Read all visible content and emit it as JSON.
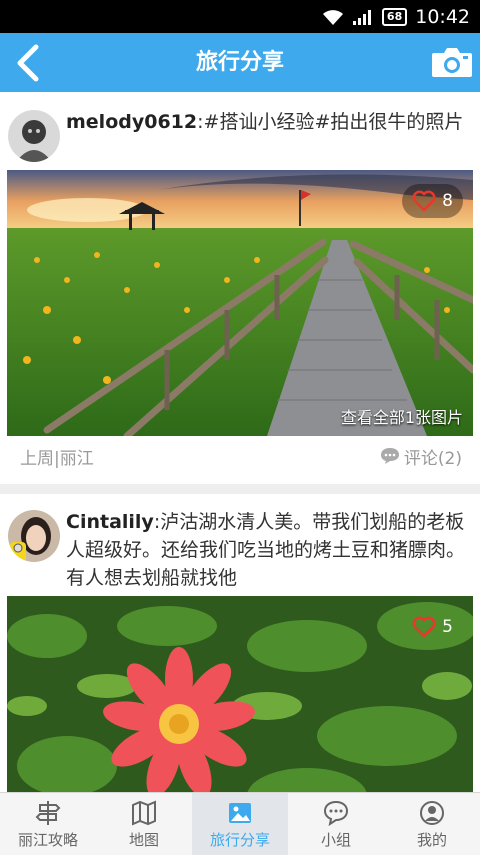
{
  "status": {
    "time": "10:42",
    "battery": "68"
  },
  "appbar": {
    "title": "旅行分享"
  },
  "posts": [
    {
      "user": "melody0612",
      "text": ":#搭讪小经验#拍出很牛的照片",
      "likes": "8",
      "view_all": "查看全部1张图片",
      "meta_left": "上周|丽江",
      "comment": "评论(2)"
    },
    {
      "user": "Cintalily",
      "text": ":泸沽湖水清人美。带我们划船的老板人超级好。还给我们吃当地的烤土豆和猪膘肉。有人想去划船就找他",
      "likes": "5"
    }
  ],
  "tabs": [
    "丽江攻略",
    "地图",
    "旅行分享",
    "小组",
    "我的"
  ],
  "colors": {
    "accent": "#3ea9ec",
    "heart": "#e8382c"
  }
}
